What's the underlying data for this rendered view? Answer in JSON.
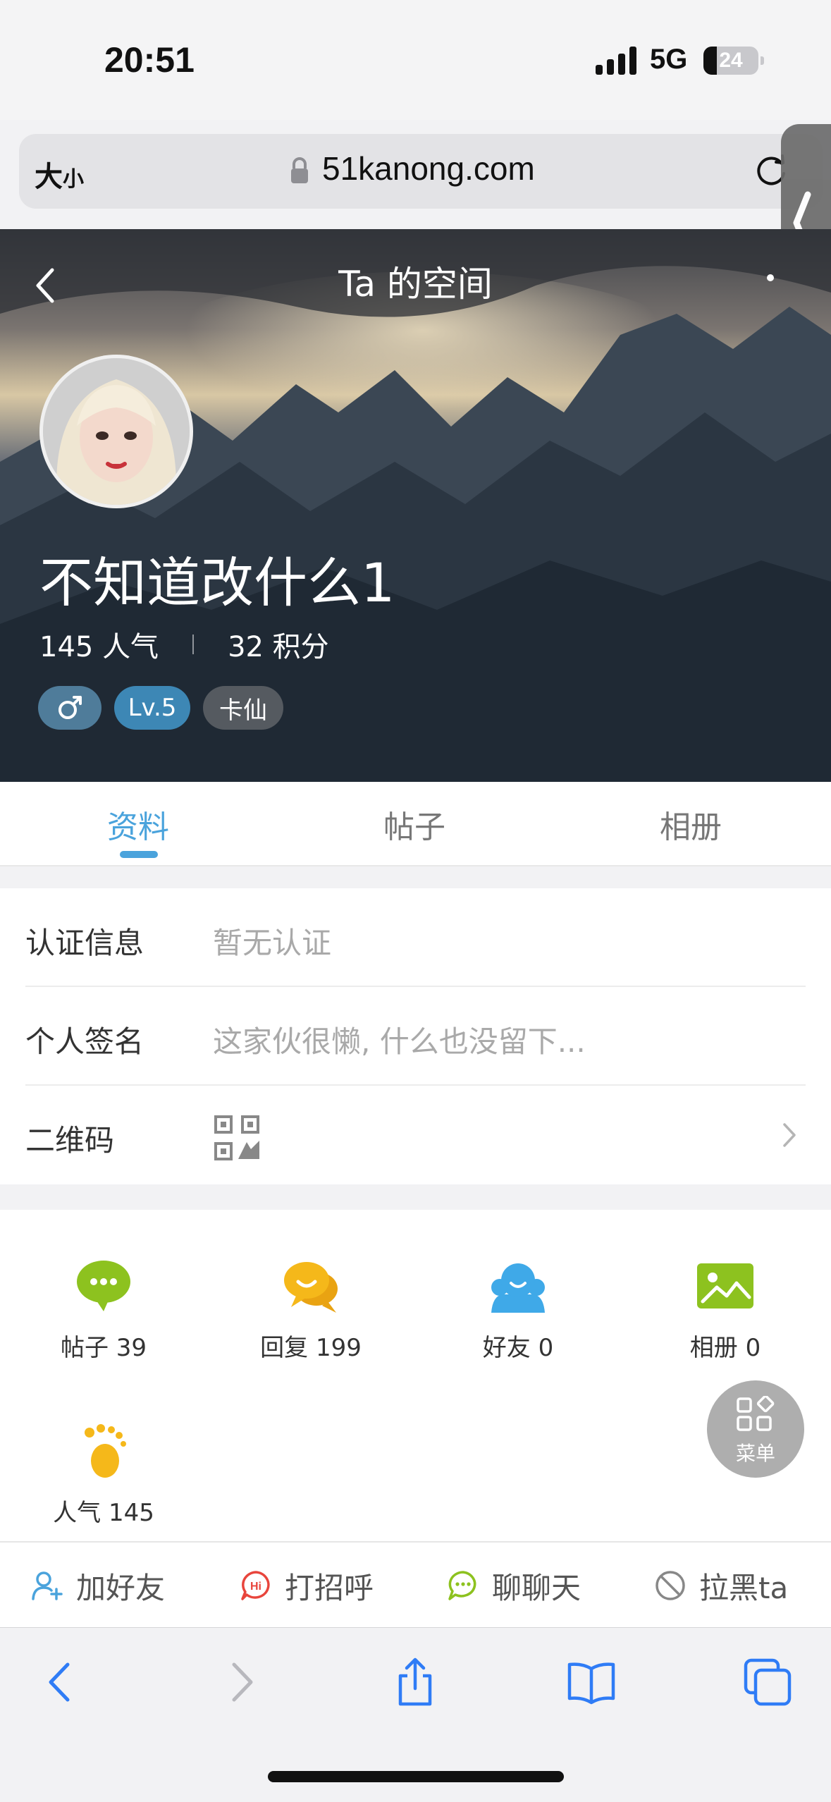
{
  "status_bar": {
    "time": "20:51",
    "network": "5G",
    "battery": "24",
    "battery_level": 0.24
  },
  "browser": {
    "text_size_label": "大",
    "text_size_small": "小",
    "url": "51kanong.com"
  },
  "header": {
    "title": "Ta 的空间"
  },
  "profile": {
    "username": "不知道改什么1",
    "popularity": "145 人气",
    "points": "32 积分",
    "tags": {
      "level": "Lv.5",
      "title": "卡仙"
    }
  },
  "tabs": [
    {
      "label": "资料",
      "active": true
    },
    {
      "label": "帖子",
      "active": false
    },
    {
      "label": "相册",
      "active": false
    }
  ],
  "info": {
    "verify_label": "认证信息",
    "verify_value": "暂无认证",
    "signature_label": "个人签名",
    "signature_value": "这家伙很懒, 什么也没留下...",
    "qrcode_label": "二维码"
  },
  "activity": {
    "posts": "帖子 39",
    "replies": "回复 199",
    "friends": "好友 0",
    "albums": "相册 0",
    "popularity": "人气 145"
  },
  "menu_fab": {
    "label": "菜单"
  },
  "actions": {
    "add_friend": "加好友",
    "greet": "打招呼",
    "chat": "聊聊天",
    "block": "拉黑ta"
  },
  "colors": {
    "accent": "#4aa3dc",
    "posts_icon": "#8dc21f",
    "replies_icon": "#f5b81a",
    "friends_icon": "#3fa9e8",
    "albums_icon": "#8dc21f",
    "footprint_icon": "#f5b81a"
  }
}
